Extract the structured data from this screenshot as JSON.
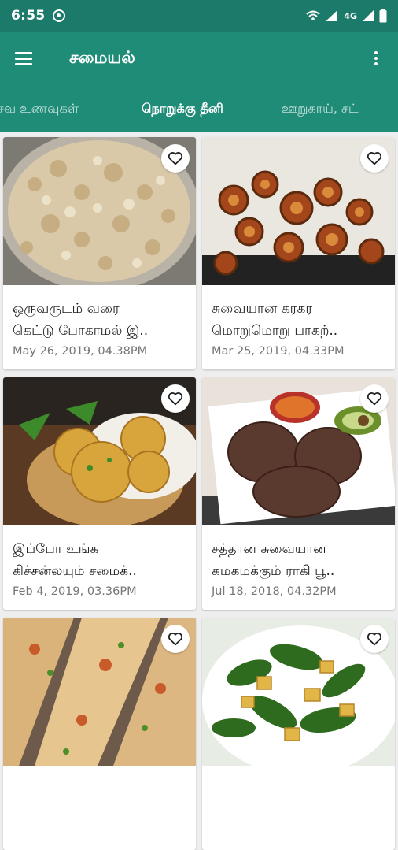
{
  "status_bar": {
    "time": "6:55",
    "network": "4G"
  },
  "app_bar": {
    "title": "சமையல்"
  },
  "tabs": [
    {
      "label": "சவ உணவுகள்"
    },
    {
      "label": "நொறுக்கு தீனி",
      "selected": true
    },
    {
      "label": "ஊறுகாய், சட்"
    }
  ],
  "cards": [
    {
      "line1": "ஒருவருடம் வரை",
      "line2": "கெட்டு போகாமல் இ..",
      "date": "May 26, 2019, 04.38PM",
      "image": "crumbled-coconut-mix-plate"
    },
    {
      "line1": "சுவையான கரகர",
      "line2": "மொறுமொறு பாகற்..",
      "date": "Mar 25, 2019, 04.33PM",
      "image": "fried-bitter-gourd-chips"
    },
    {
      "line1": "இப்போ உங்க",
      "line2": "கிச்சன்லயும் சமைக்..",
      "date": "Feb 4, 2019, 03.36PM",
      "image": "fried-kachori-basket"
    },
    {
      "line1": "சத்தான சுவையான",
      "line2": "கமகமக்கும் ராகி பூ..",
      "date": "Jul 18, 2018, 04.32PM",
      "image": "ragi-poori-plate"
    },
    {
      "line1": "",
      "line2": "",
      "date": "",
      "image": "pizza-slices"
    },
    {
      "line1": "",
      "line2": "",
      "date": "",
      "image": "potato-spinach-curry"
    }
  ],
  "colors": {
    "status_bar": "#1b7a69",
    "app_bar": "#1f8c78",
    "background": "#eeeeee"
  },
  "icons": [
    "menu-icon",
    "more-vert-icon",
    "heart-outline-icon",
    "cast-icon",
    "wifi-icon",
    "signal-icon",
    "battery-icon"
  ]
}
